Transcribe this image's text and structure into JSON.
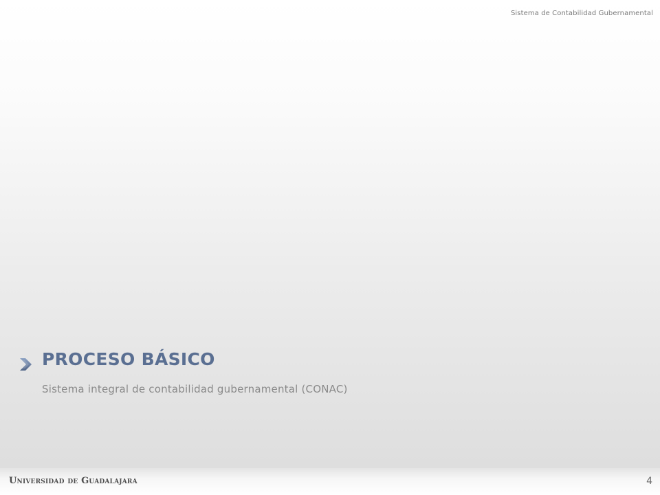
{
  "header": {
    "document_title": "Sistema de Contabilidad Gubernamental"
  },
  "section": {
    "icon": "chevron-right-icon",
    "title": "PROCESO BÁSICO",
    "subtitle": "Sistema integral de contabilidad gubernamental (CONAC)"
  },
  "footer": {
    "logo_text": "Universidad de Guadalajara",
    "page_number": "4"
  },
  "colors": {
    "title": "#5a6f92",
    "subtitle": "#8a8a8a",
    "arrow": "#5a6f92"
  }
}
